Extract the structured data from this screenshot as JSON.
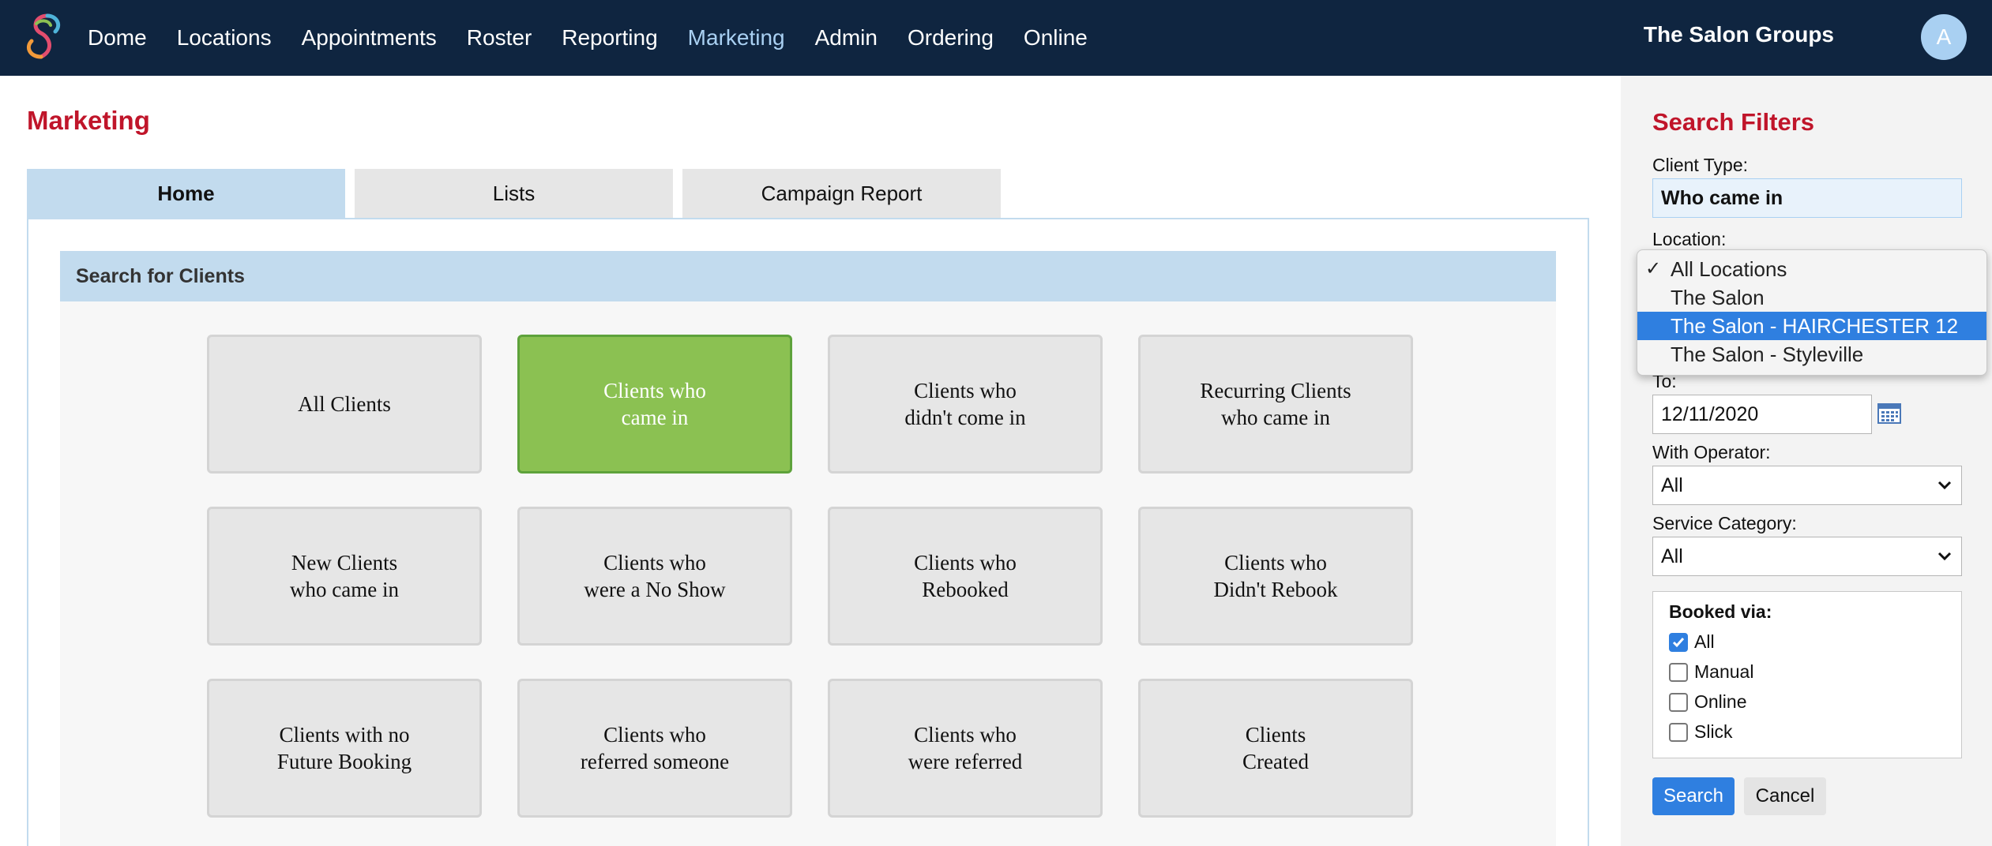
{
  "nav": {
    "items": [
      "Dome",
      "Locations",
      "Appointments",
      "Roster",
      "Reporting",
      "Marketing",
      "Admin",
      "Ordering",
      "Online"
    ],
    "active": "Marketing",
    "org_name": "The Salon Groups",
    "avatar_letter": "A"
  },
  "colors": {
    "nav_bg": "#0f2540",
    "nav_active": "#a9d0f2",
    "title_red": "#c0152a",
    "tab_active": "#c2dbee",
    "card_active": "#8bc152",
    "primary_blue": "#2f7fe0"
  },
  "page": {
    "title": "Marketing",
    "tabs": [
      {
        "label": "Home",
        "active": true
      },
      {
        "label": "Lists",
        "active": false
      },
      {
        "label": "Campaign Report",
        "active": false
      }
    ],
    "section_title": "Search for Clients",
    "cards": [
      {
        "label": "All Clients",
        "active": false
      },
      {
        "label": "Clients who\ncame in",
        "active": true
      },
      {
        "label": "Clients who\ndidn't come in",
        "active": false
      },
      {
        "label": "Recurring Clients\nwho came in",
        "active": false
      },
      {
        "label": "New Clients\nwho came in",
        "active": false
      },
      {
        "label": "Clients who\nwere a No Show",
        "active": false
      },
      {
        "label": "Clients who\nRebooked",
        "active": false
      },
      {
        "label": "Clients who\nDidn't Rebook",
        "active": false
      },
      {
        "label": "Clients with no\nFuture Booking",
        "active": false
      },
      {
        "label": "Clients who\nreferred someone",
        "active": false
      },
      {
        "label": "Clients who\nwere referred",
        "active": false
      },
      {
        "label": "Clients\nCreated",
        "active": false
      }
    ]
  },
  "filters": {
    "title": "Search Filters",
    "client_type_label": "Client Type:",
    "client_type_value": "Who came in",
    "location_label": "Location:",
    "location_options": [
      {
        "label": "All Locations",
        "checked": true,
        "highlighted": false
      },
      {
        "label": "The Salon",
        "checked": false,
        "highlighted": false
      },
      {
        "label": "The Salon - HAIRCHESTER 12",
        "checked": false,
        "highlighted": true
      },
      {
        "label": "The Salon - Styleville",
        "checked": false,
        "highlighted": false
      }
    ],
    "to_label": "To:",
    "to_value": "12/11/2020",
    "operator_label": "With Operator:",
    "operator_value": "All",
    "service_label": "Service Category:",
    "service_value": "All",
    "booked_via_title": "Booked via:",
    "booked_via": [
      {
        "label": "All",
        "checked": true
      },
      {
        "label": "Manual",
        "checked": false
      },
      {
        "label": "Online",
        "checked": false
      },
      {
        "label": "Slick",
        "checked": false
      }
    ],
    "search_label": "Search",
    "cancel_label": "Cancel"
  }
}
